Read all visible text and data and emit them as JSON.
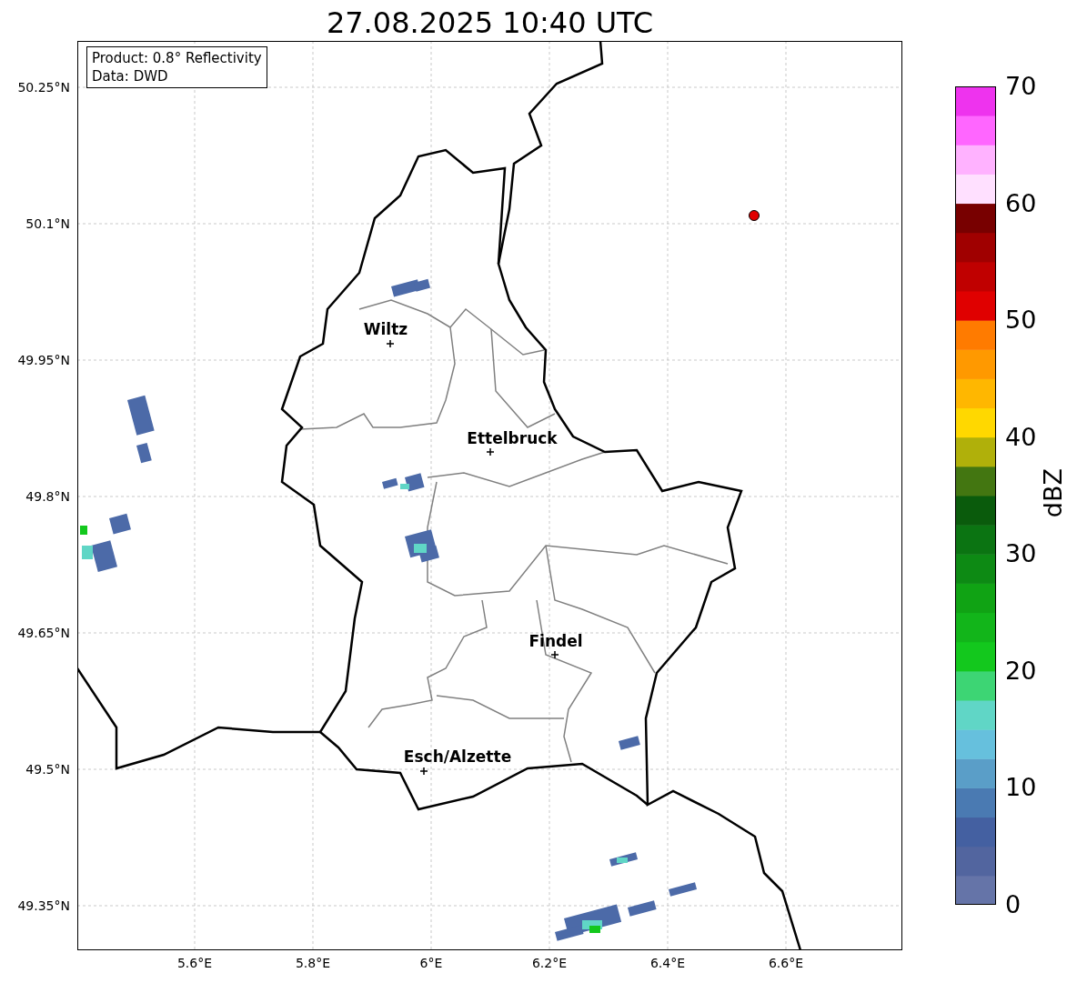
{
  "title": "27.08.2025 10:40 UTC",
  "info_box": [
    "Product: 0.8° Reflectivity",
    "Data: DWD"
  ],
  "cities": [
    {
      "name": "Wiltz"
    },
    {
      "name": "Ettelbruck"
    },
    {
      "name": "Findel"
    },
    {
      "name": "Esch/Alzette"
    }
  ],
  "y_ticks": [
    "50.25°N",
    "50.1°N",
    "49.95°N",
    "49.8°N",
    "49.65°N",
    "49.5°N",
    "49.35°N"
  ],
  "x_ticks": [
    "5.6°E",
    "5.8°E",
    "6°E",
    "6.2°E",
    "6.4°E",
    "6.6°E"
  ],
  "colorbar": {
    "label": "dBZ",
    "ticks": [
      "70",
      "60",
      "50",
      "40",
      "30",
      "20",
      "10",
      "0"
    ]
  }
}
